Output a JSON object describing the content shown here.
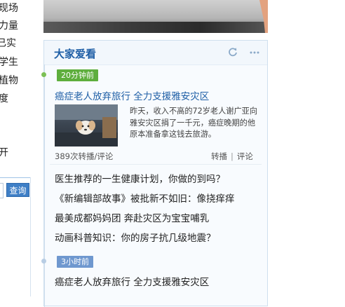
{
  "left_sidebar": {
    "items": [
      "现场",
      "力量",
      "已实",
      "学生",
      "植物",
      "度",
      "开"
    ],
    "query_button": "查询"
  },
  "widget": {
    "title": "大家爱看",
    "icons": [
      "refresh-icon",
      "more-icon"
    ],
    "group1": {
      "time_label": "20分钟前",
      "badge_color": "#5eae3d",
      "headline": "癌症老人放弃旅行  全力支援雅安灾区",
      "summary": "昨天，收入不高的72岁老人谢广亚向雅安灾区捐了一千元，癌症晚期的他原本准备拿这钱去旅游。",
      "stats": "389次转播/评论",
      "repost_label": "转播",
      "separator": "|",
      "comment_label": "评论",
      "related": [
        "医生推荐的一生健康计划，你做的到吗？",
        "《新编辑部故事》被批新不如旧：像挠痒痒",
        "最美成都妈妈团 奔赴灾区为宝宝哺乳",
        "动画科普知识：你的房子抗几级地震？"
      ]
    },
    "group2": {
      "time_label": "3小时前",
      "badge_color": "#6f98cf",
      "headline": "癌症老人放弃旅行  全力支援雅安灾区"
    }
  }
}
